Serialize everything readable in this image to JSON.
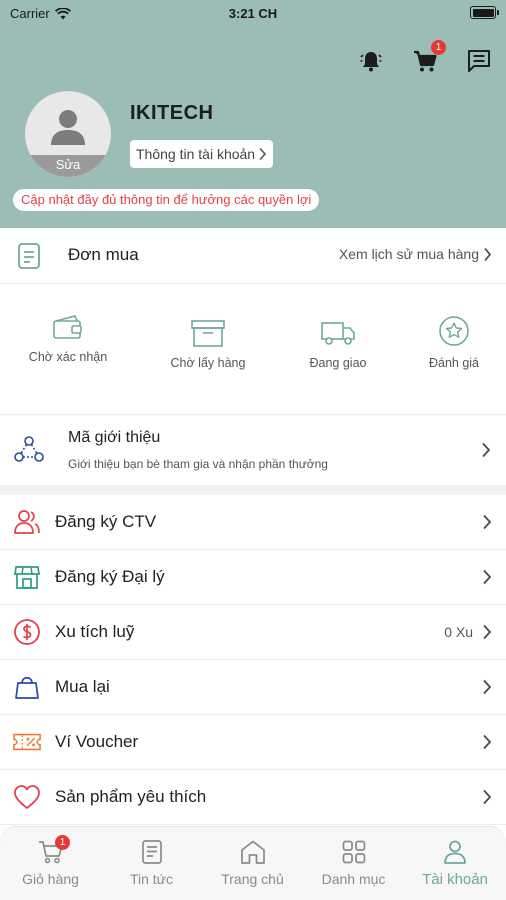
{
  "statusbar": {
    "carrier": "Carrier",
    "time": "3:21 CH"
  },
  "header": {
    "cart_badge": "1",
    "avatar_edit": "Sửa",
    "user_name": "IKITECH",
    "account_info": "Thông tin tài khoản",
    "update_msg": "Cập nhật đầy đủ thông tin để hưởng các quyền lợi"
  },
  "orders": {
    "title": "Đơn mua",
    "history_link": "Xem lịch sử mua hàng",
    "statuses": [
      {
        "label": "Chờ xác nhận",
        "icon": "wallet-icon"
      },
      {
        "label": "Chờ lấy hàng",
        "icon": "box-icon"
      },
      {
        "label": "Đang giao",
        "icon": "truck-icon"
      },
      {
        "label": "Đánh giá",
        "icon": "star-icon"
      }
    ]
  },
  "referral": {
    "title": "Mã giới thiệu",
    "subtitle": "Giới thiệu bạn bè tham gia và nhận phần thưởng"
  },
  "menu": [
    {
      "label": "Đăng ký CTV",
      "value": "",
      "icon": "users-icon",
      "color": "#e0424a"
    },
    {
      "label": "Đăng ký Đại lý",
      "value": "",
      "icon": "store-icon",
      "color": "#2e9d7e"
    },
    {
      "label": "Xu tích luỹ",
      "value": "0 Xu",
      "icon": "coin-icon",
      "color": "#e0424a"
    },
    {
      "label": "Mua lại",
      "value": "",
      "icon": "bag-icon",
      "color": "#2b49a8"
    },
    {
      "label": "Ví Voucher",
      "value": "",
      "icon": "voucher-icon",
      "color": "#f07a3a"
    },
    {
      "label": "Sản phẩm yêu thích",
      "value": "",
      "icon": "heart-icon",
      "color": "#e0424a"
    }
  ],
  "bottom_nav": {
    "cart_badge": "1",
    "items": [
      {
        "label": "Giỏ hàng",
        "icon": "cart-icon"
      },
      {
        "label": "Tin tức",
        "icon": "news-icon"
      },
      {
        "label": "Trang chủ",
        "icon": "home-icon"
      },
      {
        "label": "Danh mục",
        "icon": "grid-icon"
      },
      {
        "label": "Tài khoản",
        "icon": "person-icon"
      }
    ]
  },
  "colors": {
    "header_bg": "#9bbdb5",
    "accent": "#6ea89c",
    "badge": "#e53935",
    "warning_text": "#e0424a"
  }
}
